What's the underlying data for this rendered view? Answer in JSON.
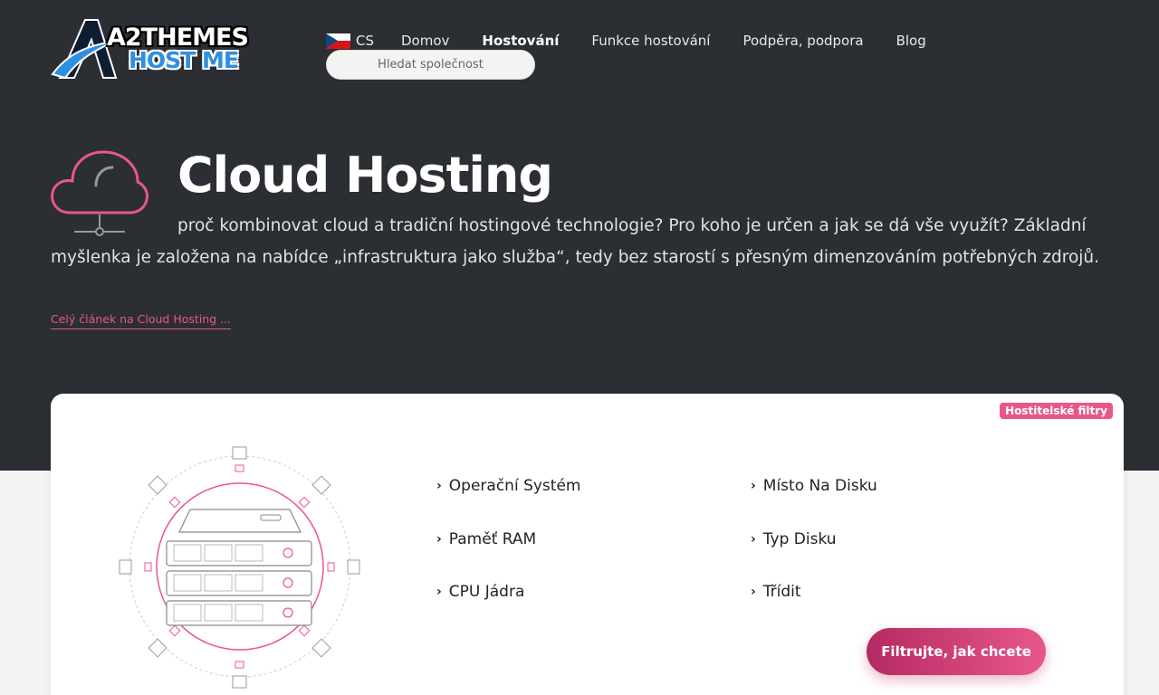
{
  "logo": {
    "line1": "A2THEMES",
    "line2": "HOST ME"
  },
  "nav": {
    "lang": "CS",
    "items": [
      "Domov",
      "Hostování",
      "Funkce hostování",
      "Podpěra, podpora",
      "Blog"
    ],
    "active": "Hostování"
  },
  "search": {
    "placeholder": "Hledat společnost"
  },
  "hero": {
    "title": "Cloud Hosting",
    "description": "proč kombinovat cloud a tradiční hostingové technologie? Pro koho je určen a jak se dá vše využít? Základní myšlenka je založena na nabídce „infrastruktura jako služba“, tedy bez starostí s přesným dimenzováním potřebných zdrojů.",
    "more_link": "Celý článek na Cloud Hosting ..."
  },
  "card": {
    "badge": "Hostitelské filtry",
    "filters": [
      "Operační Systém",
      "Místo Na Disku",
      "Paměť RAM",
      "Typ Disku",
      "CPU Jádra",
      "Třídit"
    ],
    "cta": "Filtrujte, jak chcete"
  },
  "colors": {
    "accent": "#e8578a",
    "dark": "#2b2e33",
    "brand_blue": "#2f8fe0"
  }
}
